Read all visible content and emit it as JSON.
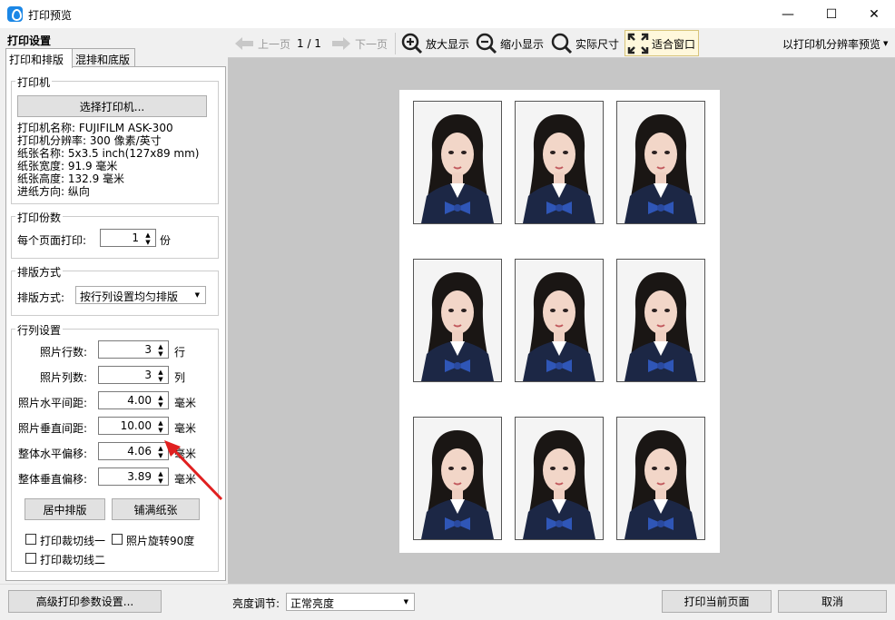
{
  "window": {
    "title": "打印预览",
    "minimize": "—",
    "maximize": "☐",
    "close": "✕"
  },
  "left": {
    "header": "打印设置",
    "tabs": [
      "打印和排版",
      "混排和底版"
    ],
    "printer": {
      "title": "打印机",
      "select_button": "选择打印机...",
      "info": [
        "打印机名称: FUJIFILM ASK-300",
        "打印机分辨率: 300 像素/英寸",
        "纸张名称: 5x3.5 inch(127x89 mm)",
        "纸张宽度: 91.9 毫米",
        "纸张高度: 132.9 毫米",
        "进纸方向: 纵向"
      ]
    },
    "copies": {
      "title": "打印份数",
      "label": "每个页面打印:",
      "value": "1",
      "unit": "份"
    },
    "layout": {
      "title": "排版方式",
      "label": "排版方式:",
      "value": "按行列设置均匀排版"
    },
    "grid": {
      "title": "行列设置",
      "fields": [
        {
          "label": "照片行数:",
          "value": "3",
          "unit": "行"
        },
        {
          "label": "照片列数:",
          "value": "3",
          "unit": "列"
        },
        {
          "label": "照片水平间距:",
          "value": "4.00",
          "unit": "毫米"
        },
        {
          "label": "照片垂直间距:",
          "value": "10.00",
          "unit": "毫米"
        },
        {
          "label": "整体水平偏移:",
          "value": "4.06",
          "unit": "毫米"
        },
        {
          "label": "整体垂直偏移:",
          "value": "3.89",
          "unit": "毫米"
        }
      ],
      "center_button": "居中排版",
      "fill_button": "铺满纸张",
      "checkboxes": [
        "打印裁切线一",
        "照片旋转90度",
        "打印裁切线二"
      ]
    }
  },
  "toolbar": {
    "prev": "上一页",
    "page": "1 / 1",
    "next": "下一页",
    "zoom_in": "放大显示",
    "zoom_out": "缩小显示",
    "actual_size": "实际尺寸",
    "fit_window": "适合窗口",
    "preview_mode": "以打印机分辨率预览"
  },
  "bottom": {
    "advanced": "高级打印参数设置...",
    "brightness_label": "亮度调节:",
    "brightness_value": "正常亮度",
    "print_page": "打印当前页面",
    "cancel": "取消"
  },
  "colors": {
    "accent": "#1b87e6",
    "arrow": "#e02020",
    "preview_bg": "#c6c6c6"
  }
}
